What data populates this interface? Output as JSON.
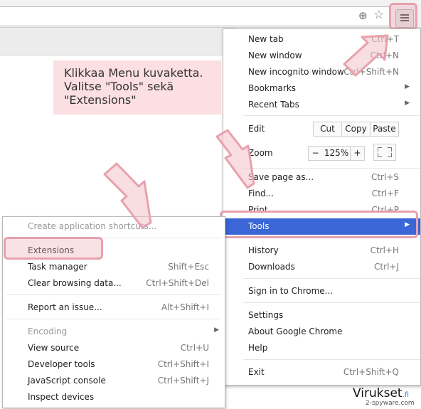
{
  "instruction": {
    "lines": [
      "Klikkaa Menu kuvaketta.",
      "Valitse \"Tools\" sekä",
      "\"Extensions\""
    ]
  },
  "toolbar": {
    "zoom_icon": "magnifier-plus-icon",
    "star_icon": "bookmark-star-icon",
    "menu_icon": "hamburger-menu-icon"
  },
  "menu": {
    "new_tab": {
      "label": "New tab",
      "shortcut": "Ctrl+T"
    },
    "new_window": {
      "label": "New window",
      "shortcut": "Ctrl+N"
    },
    "new_incognito": {
      "label": "New incognito window",
      "shortcut": "Ctrl+Shift+N"
    },
    "bookmarks": {
      "label": "Bookmarks"
    },
    "recent_tabs": {
      "label": "Recent Tabs"
    },
    "edit": {
      "label": "Edit",
      "cut": "Cut",
      "copy": "Copy",
      "paste": "Paste"
    },
    "zoom": {
      "label": "Zoom",
      "minus": "−",
      "value": "125%",
      "plus": "+"
    },
    "save_page": {
      "label": "Save page as...",
      "shortcut": "Ctrl+S"
    },
    "find": {
      "label": "Find...",
      "shortcut": "Ctrl+F"
    },
    "print": {
      "label": "Print...",
      "shortcut": "Ctrl+P"
    },
    "tools": {
      "label": "Tools"
    },
    "history": {
      "label": "History",
      "shortcut": "Ctrl+H"
    },
    "downloads": {
      "label": "Downloads",
      "shortcut": "Ctrl+J"
    },
    "sign_in": {
      "label": "Sign in to Chrome..."
    },
    "settings": {
      "label": "Settings"
    },
    "about": {
      "label": "About Google Chrome"
    },
    "help": {
      "label": "Help"
    },
    "exit": {
      "label": "Exit",
      "shortcut": "Ctrl+Shift+Q"
    }
  },
  "submenu": {
    "create_shortcuts": {
      "label": "Create application shortcuts..."
    },
    "extensions": {
      "label": "Extensions"
    },
    "task_manager": {
      "label": "Task manager",
      "shortcut": "Shift+Esc"
    },
    "clear_browsing": {
      "label": "Clear browsing data...",
      "shortcut": "Ctrl+Shift+Del"
    },
    "report_issue": {
      "label": "Report an issue...",
      "shortcut": "Alt+Shift+I"
    },
    "encoding": {
      "label": "Encoding"
    },
    "view_source": {
      "label": "View source",
      "shortcut": "Ctrl+U"
    },
    "developer_tools": {
      "label": "Developer tools",
      "shortcut": "Ctrl+Shift+I"
    },
    "js_console": {
      "label": "JavaScript console",
      "shortcut": "Ctrl+Shift+J"
    },
    "inspect_devices": {
      "label": "Inspect devices"
    }
  },
  "watermark": {
    "brand": "Virukset",
    "tld": ".fi",
    "tagline": "2-spyware.com"
  },
  "colors": {
    "highlight": "#3a66d8",
    "annotation_pink": "#e8a1ad",
    "note_bg": "#fbdfe2"
  }
}
